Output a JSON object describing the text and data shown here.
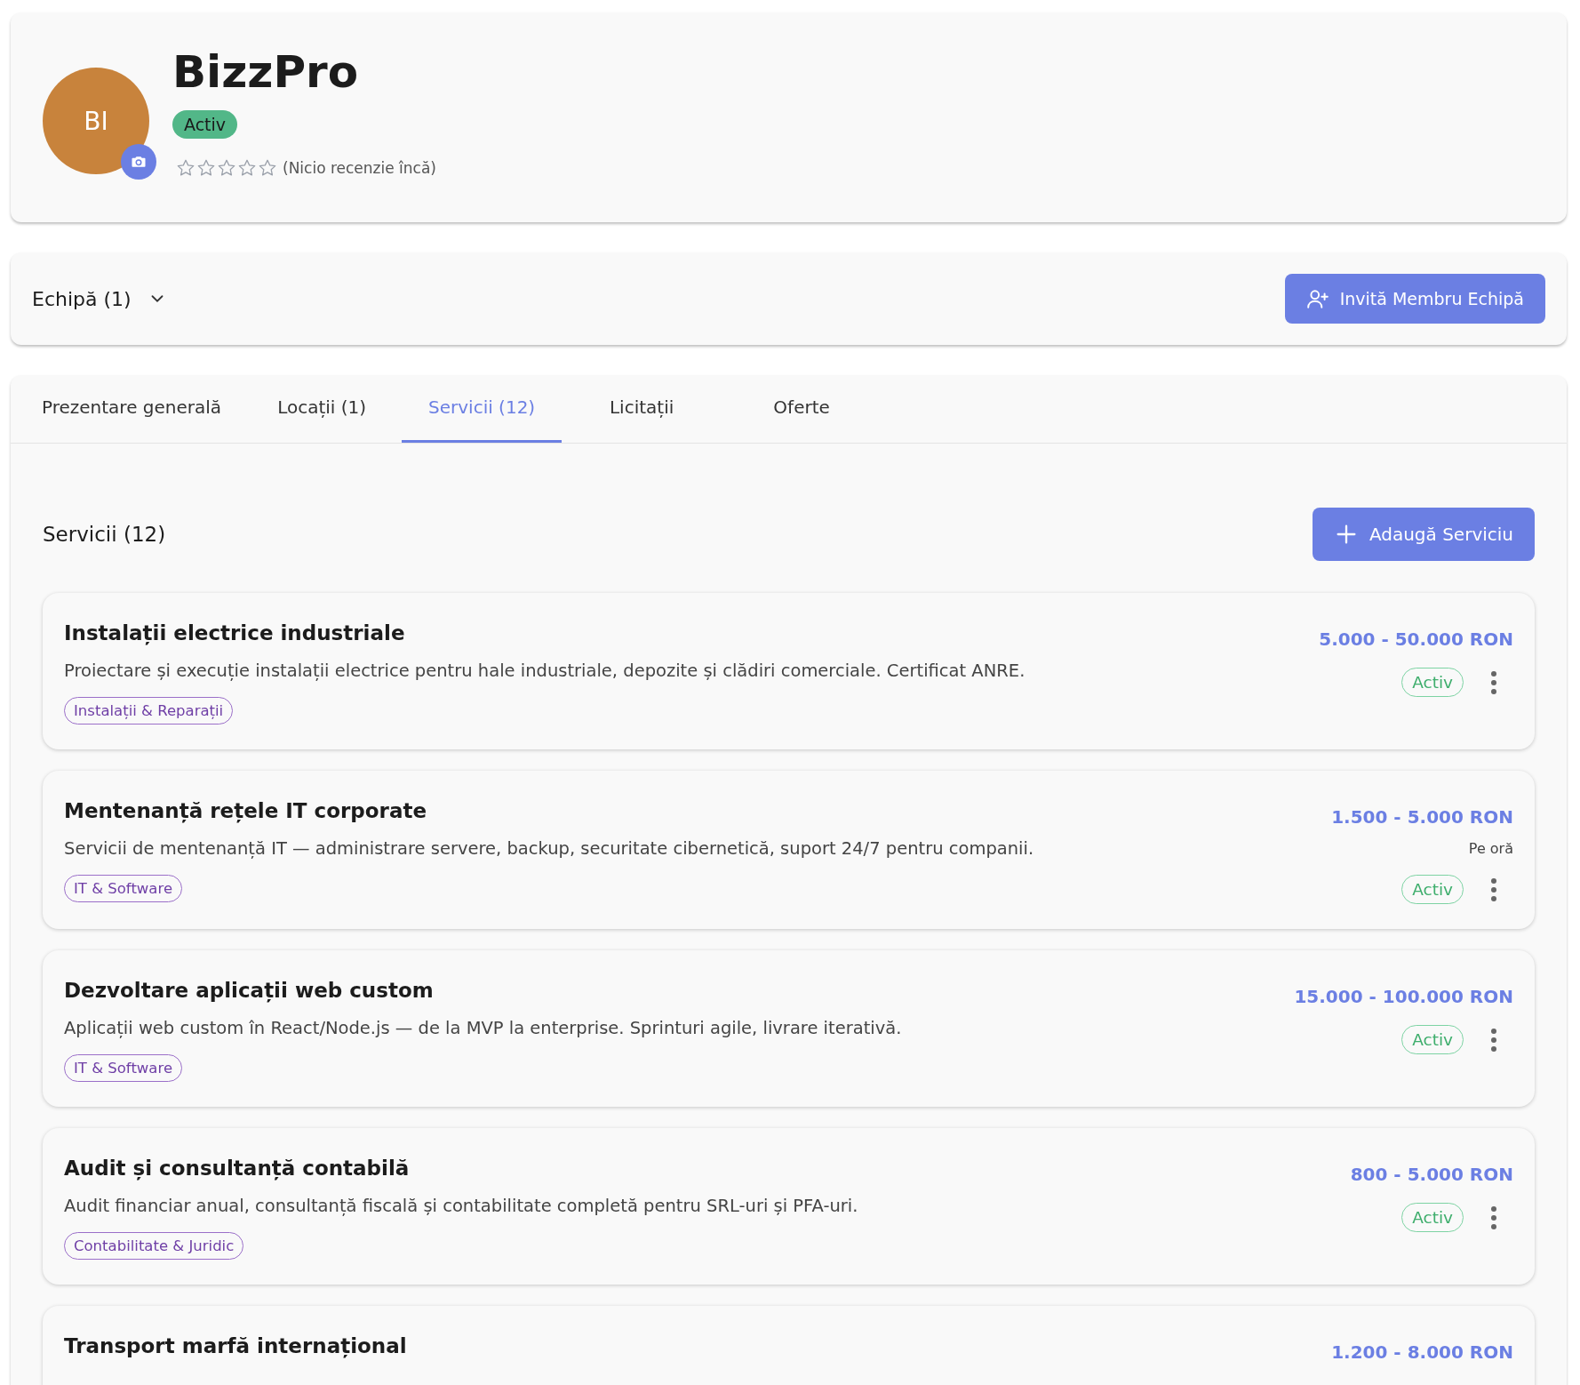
{
  "profile": {
    "initials": "BI",
    "name": "BizzPro",
    "status": "Activ",
    "stars": 0,
    "reviews_text": "(Nicio recenzie încă)"
  },
  "team": {
    "label": "Echipă (1)",
    "expanded": false,
    "invite_button": "Invită Membru Echipă"
  },
  "tabs": [
    {
      "label": "Prezentare generală",
      "selected": false
    },
    {
      "label": "Locații (1)",
      "selected": false
    },
    {
      "label": "Servicii (12)",
      "selected": true
    },
    {
      "label": "Licitații",
      "selected": false
    },
    {
      "label": "Oferte",
      "selected": false
    }
  ],
  "services_panel": {
    "heading": "Servicii (12)",
    "add_button": "Adaugă Serviciu",
    "services": [
      {
        "title": "Instalații electrice industriale",
        "description": "Proiectare și execuție instalații electrice pentru hale industriale, depozite și clădiri comerciale. Certificat ANRE.",
        "category": "Instalații & Reparații",
        "price": "5.000 - 50.000 RON",
        "status": "Activ"
      },
      {
        "title": "Mentenanță rețele IT corporate",
        "description": "Servicii de mentenanță IT — administrare servere, backup, securitate cibernetică, suport 24/7 pentru companii.",
        "category": "IT & Software",
        "price": "1.500 - 5.000 RON",
        "price_unit": "Pe oră",
        "status": "Activ"
      },
      {
        "title": "Dezvoltare aplicații web custom",
        "description": "Aplicații web custom în React/Node.js — de la MVP la enterprise. Sprinturi agile, livrare iterativă.",
        "category": "IT & Software",
        "price": "15.000 - 100.000 RON",
        "status": "Activ"
      },
      {
        "title": "Audit și consultanță contabilă",
        "description": "Audit financiar anual, consultanță fiscală și contabilitate completă pentru SRL-uri și PFA-uri.",
        "category": "Contabilitate & Juridic",
        "price": "800 - 5.000 RON",
        "status": "Activ"
      },
      {
        "title": "Transport marfă internațional",
        "price": "1.200 - 8.000 RON"
      }
    ]
  }
}
